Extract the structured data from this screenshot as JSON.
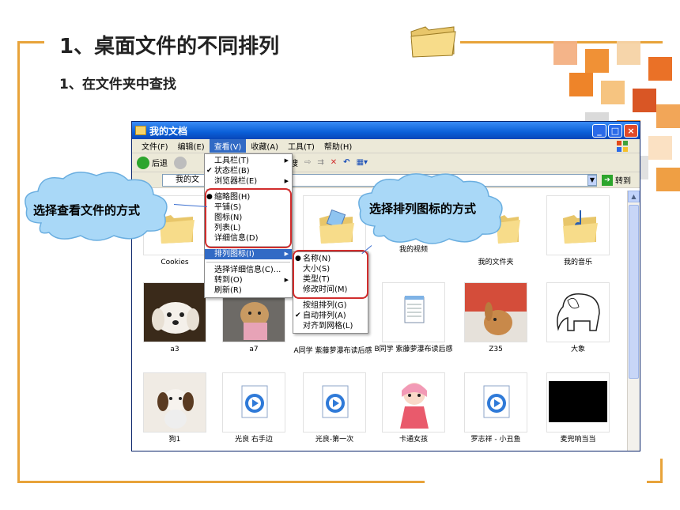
{
  "slide": {
    "title": "1、桌面文件的不同排列",
    "subtitle": "1、在文件夹中查找"
  },
  "colors": {
    "frame": "#e8a33a",
    "xp_title": "#0a5fd8",
    "highlight": "#316ac5",
    "annotation_red": "#d12d2d",
    "cloud": "#9fd1f5"
  },
  "window": {
    "title": "我的文档",
    "controls": [
      "_",
      "□",
      "×"
    ],
    "menubar": [
      {
        "label": "文件(F)"
      },
      {
        "label": "编辑(E)"
      },
      {
        "label": "查看(V)",
        "active": true
      },
      {
        "label": "收藏(A)"
      },
      {
        "label": "工具(T)"
      },
      {
        "label": "帮助(H)"
      }
    ],
    "toolbar": {
      "back_label": "后退",
      "search_label": "搜"
    },
    "address": {
      "value": "我的文",
      "go_label": "转到",
      "dropdown": "▼"
    }
  },
  "view_menu": {
    "group1": [
      {
        "label": "工具栏(T)",
        "submenu": true,
        "checked": false
      },
      {
        "label": "状态栏(B)",
        "submenu": false,
        "checked": true
      },
      {
        "label": "浏览器栏(E)",
        "submenu": true,
        "checked": false
      }
    ],
    "group2": [
      {
        "label": "缩略图(H)",
        "radio": true
      },
      {
        "label": "平铺(S)",
        "radio": false
      },
      {
        "label": "图标(N)",
        "radio": false
      },
      {
        "label": "列表(L)",
        "radio": false
      },
      {
        "label": "详细信息(D)",
        "radio": false
      }
    ],
    "group3": [
      {
        "label": "排列图标(I)",
        "submenu": true,
        "highlighted": true
      }
    ],
    "group4": [
      {
        "label": "选择详细信息(C)...",
        "submenu": false
      },
      {
        "label": "转到(O)",
        "submenu": true
      },
      {
        "label": "刷新(R)",
        "submenu": false
      }
    ]
  },
  "arrange_menu": {
    "sort": [
      {
        "label": "名称(N)",
        "radio": true
      },
      {
        "label": "大小(S)",
        "radio": false
      },
      {
        "label": "类型(T)",
        "radio": false
      },
      {
        "label": "修改时间(M)",
        "radio": false
      }
    ],
    "options": [
      {
        "label": "按组排列(G)",
        "checked": false
      },
      {
        "label": "自动排列(A)",
        "checked": true
      },
      {
        "label": "对齐到网格(L)",
        "checked": false
      }
    ]
  },
  "files": [
    {
      "label": "Cookies",
      "kind": "folder"
    },
    {
      "label": "",
      "kind": "hidden"
    },
    {
      "label": "",
      "kind": "photo-folder"
    },
    {
      "label": "我的视频",
      "kind": "folder"
    },
    {
      "label": "我的文件夹",
      "kind": "folder"
    },
    {
      "label": "我的音乐",
      "kind": "music-folder"
    },
    {
      "label": "a3",
      "kind": "dog-white"
    },
    {
      "label": "a7",
      "kind": "dog-brown"
    },
    {
      "label": "A同学 紫藤萝瀑布读后感",
      "kind": "none"
    },
    {
      "label": "B同学 紫藤萝瀑布读后感",
      "kind": "notepad"
    },
    {
      "label": "Z35",
      "kind": "rabbit"
    },
    {
      "label": "大象",
      "kind": "elephant"
    },
    {
      "label": "狗1",
      "kind": "dog-shihtzu"
    },
    {
      "label": "光良 右手边",
      "kind": "media"
    },
    {
      "label": "光良-第一次",
      "kind": "media"
    },
    {
      "label": "卡通女孩",
      "kind": "cartoon-girl"
    },
    {
      "label": "罗志祥 - 小丑鱼",
      "kind": "media"
    },
    {
      "label": "麦兜响当当",
      "kind": "black"
    }
  ],
  "callouts": {
    "view": "选择查看文件的方式",
    "arrange": "选择排列图标的方式"
  }
}
